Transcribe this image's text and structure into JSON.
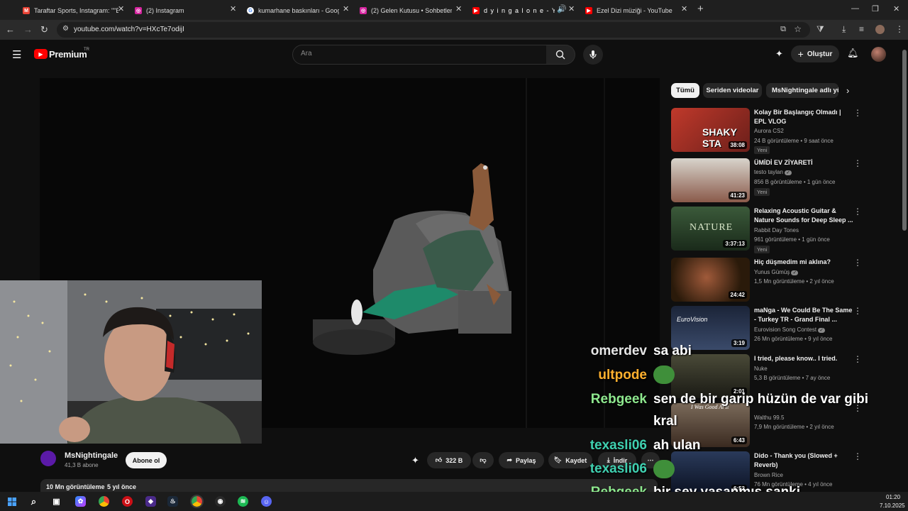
{
  "browser": {
    "tabs": [
      {
        "label": "Taraftar Sports, Instagram: \"\"Bu",
        "icon": "gmail-icon",
        "color": "#ea4335"
      },
      {
        "label": "(2) Instagram",
        "icon": "instagram-icon",
        "color": "#d6249f"
      },
      {
        "label": "kumarhane baskınları - Google",
        "icon": "google-icon",
        "color": "#4285f4"
      },
      {
        "label": "(2) Gelen Kutusu • Sohbetler",
        "icon": "instagram-icon",
        "color": "#d6249f"
      },
      {
        "label": "d y i n g a l o n e - Yo",
        "icon": "youtube-icon",
        "color": "#ff0000"
      },
      {
        "label": "Ezel Dizi müziği - YouTube",
        "icon": "youtube-icon",
        "color": "#ff0000"
      }
    ],
    "url": "youtube.com/watch?v=HXcTe7odijI"
  },
  "header": {
    "logo_text": "Premium",
    "logo_badge": "TR",
    "search_placeholder": "Ara",
    "create_label": "Oluştur"
  },
  "video": {
    "channel_name": "MsNightingale",
    "subscribers": "41,3 B abone",
    "subscribe_label": "Abone ol",
    "likes": "322 B",
    "share_label": "Paylaş",
    "save_label": "Kaydet",
    "download_label": "İndir",
    "views": "10 Mn görüntüleme",
    "age": "5 yıl önce"
  },
  "chips": [
    "Tümü",
    "Seriden videolar",
    "MsNightingale adlı yü"
  ],
  "recommendations": [
    {
      "title": "Kolay Bir Başlangıç Olmadı | EPL VLOG",
      "channel": "Aurora CS2",
      "verified": false,
      "meta": "24 B görüntüleme • 9 saat önce",
      "new": "Yeni",
      "duration": "38:08",
      "thumb_color": "#b0322c",
      "thumb_text": "SHAKY STA"
    },
    {
      "title": "ÜMİDİ EV ZİYARETİ",
      "channel": "testo taylan",
      "verified": true,
      "meta": "856 B görüntüleme • 1 gün önce",
      "new": "Yeni",
      "duration": "41:23",
      "thumb_color": "#a9a39a",
      "thumb_text": ""
    },
    {
      "title": "Relaxing Acoustic Guitar & Nature Sounds for Deep Sleep ...",
      "channel": "Rabbit Day Tones",
      "verified": false,
      "meta": "961 görüntüleme • 1 gün önce",
      "new": "Yeni",
      "duration": "3:37:13",
      "thumb_color": "#2f4a30",
      "thumb_text": "NATURE"
    },
    {
      "title": "Hiç düşmedim mi aklına?",
      "channel": "Yunus Gümüş",
      "verified": true,
      "meta": "1,5 Mn görüntüleme • 2 yıl önce",
      "new": "",
      "duration": "24:42",
      "thumb_color": "#4a3a1c",
      "thumb_text": ""
    },
    {
      "title": "maNga - We Could Be The Same - Turkey TR - Grand Final ...",
      "channel": "Eurovision Song Contest",
      "verified": true,
      "meta": "26 Mn görüntüleme • 9 yıl önce",
      "new": "",
      "duration": "3:19",
      "thumb_color": "#2a3550",
      "thumb_text": "EuroVision"
    },
    {
      "title": "I tried, please know.. I tried.",
      "channel": "Nuke",
      "verified": false,
      "meta": "5,3 B görüntüleme • 7 ay önce",
      "new": "",
      "duration": "2:01",
      "thumb_color": "#3c3a2e",
      "thumb_text": ""
    },
    {
      "title": "",
      "channel": "Walthu 99.5",
      "verified": false,
      "meta": "7,9 Mn görüntüleme • 2 yıl önce",
      "new": "",
      "duration": "6:43",
      "thumb_color": "#6a5a4a",
      "thumb_text": "I Was Good At It"
    },
    {
      "title": "Dido - Thank you (Slowed + Reverb)",
      "channel": "Brown Rice",
      "verified": false,
      "meta": "76 Mn görüntüleme • 4 yıl önce",
      "new": "",
      "duration": "6:53",
      "thumb_color": "#1e2a45",
      "thumb_text": ""
    }
  ],
  "chat": [
    {
      "name": "omerdev",
      "color": "#e6e6e6",
      "message": "sa abi",
      "emote": false
    },
    {
      "name": "ultpode",
      "color": "#ffb02e",
      "message": "",
      "emote": true
    },
    {
      "name": "Rebgeek",
      "color": "#8ee88e",
      "message": "sen de bir garip hüzün de var gibi",
      "emote": false
    },
    {
      "name": "",
      "color": "#ffffff",
      "message": "kral",
      "emote": false
    },
    {
      "name": "texasli06",
      "color": "#3fd0b0",
      "message": "ah ulan",
      "emote": false
    },
    {
      "name": "texasli06",
      "color": "#3fd0b0",
      "message": "",
      "emote": true
    },
    {
      "name": "Rebgeek",
      "color": "#8ee88e",
      "message": "bir şey yaşanmış sanki",
      "emote": false
    }
  ],
  "taskbar": {
    "time": "01:20",
    "date": "7.10.2025"
  },
  "colors": {
    "youtube_red": "#ff0000",
    "background": "#0f0f0f",
    "chip_bg": "#272727"
  }
}
